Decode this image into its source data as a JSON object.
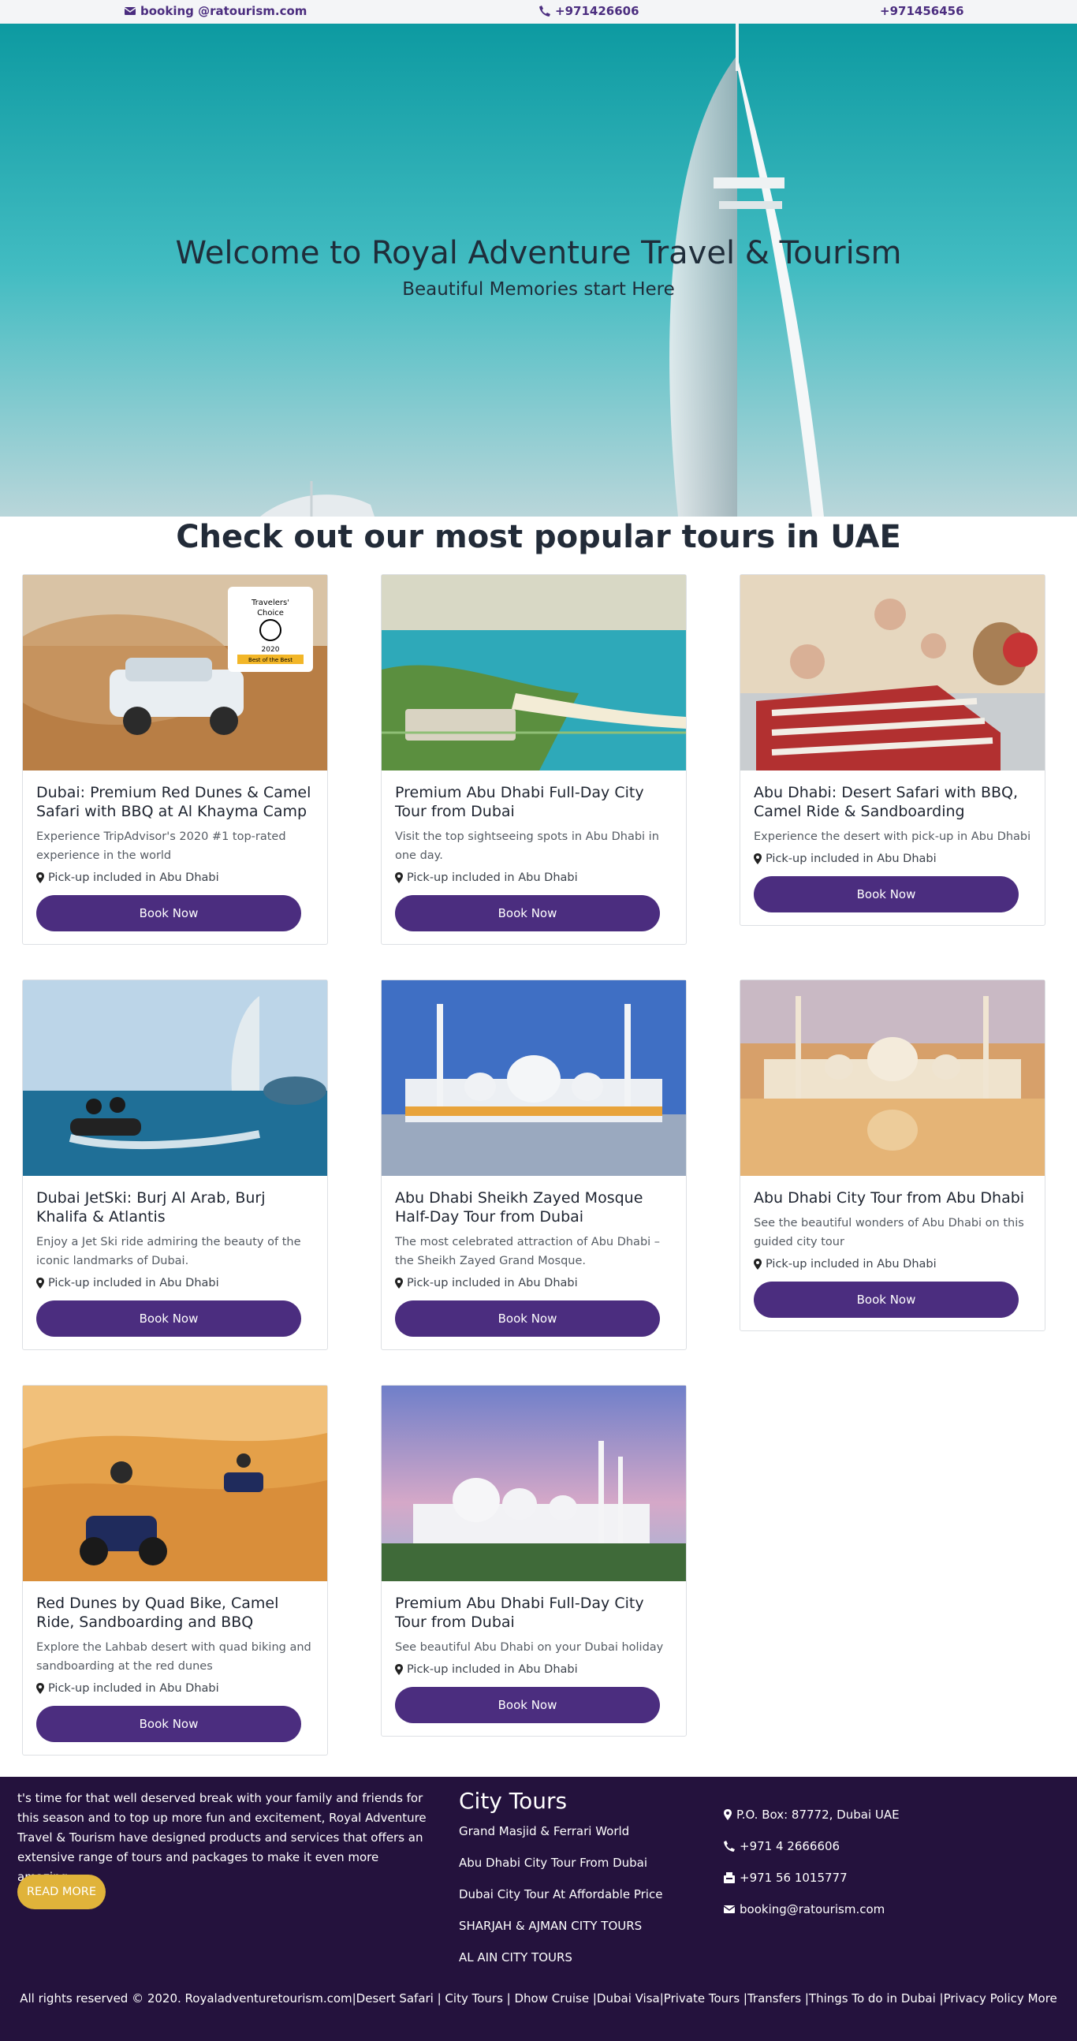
{
  "topbar": {
    "email": "booking @ratourism.com",
    "phone1": "+971426606",
    "phone2": "+971456456"
  },
  "hero": {
    "title": "Welcome to Royal Adventure Travel & Tourism",
    "subtitle": "Beautiful Memories start Here"
  },
  "section": {
    "title": "Check out our most popular tours in UAE"
  },
  "badge": {
    "line1": "Travelers'",
    "line2": "Choice",
    "year": "2020",
    "ribbon": "Best of the Best"
  },
  "tours": [
    {
      "title": "Dubai: Premium Red Dunes & Camel Safari with BBQ at Al Khayma Camp",
      "desc": "Experience TripAdvisor's 2020 #1 top-rated experience in the world",
      "pickup": "Pick-up included in Abu Dhabi",
      "button": "Book Now",
      "image": "desert-suv-image"
    },
    {
      "title": "Premium Abu Dhabi Full-Day City Tour from Dubai",
      "desc": "Visit the top sightseeing spots in Abu Dhabi in one day.",
      "pickup": "Pick-up included in Abu Dhabi",
      "button": "Book Now",
      "image": "coastline-image"
    },
    {
      "title": "Abu Dhabi: Desert Safari with BBQ, Camel Ride & Sandboarding",
      "desc": "Experience the desert with pick-up in Abu Dhabi",
      "pickup": "Pick-up included in Abu Dhabi",
      "button": "Book Now",
      "image": "camel-ride-image"
    },
    {
      "title": "Dubai JetSki: Burj Al Arab, Burj Khalifa & Atlantis",
      "desc": "Enjoy a Jet Ski ride admiring the beauty of the iconic landmarks of Dubai.",
      "pickup": "Pick-up included in Abu Dhabi",
      "button": "Book Now",
      "image": "jetski-image"
    },
    {
      "title": "Abu Dhabi Sheikh Zayed Mosque Half-Day Tour from Dubai",
      "desc": "The most celebrated attraction of Abu Dhabi – the Sheikh Zayed Grand Mosque.",
      "pickup": "Pick-up included in Abu Dhabi",
      "button": "Book Now",
      "image": "mosque-blue-image"
    },
    {
      "title": "Abu Dhabi City Tour from Abu Dhabi",
      "desc": "See the beautiful wonders of Abu Dhabi on this guided city tour",
      "pickup": "Pick-up included in Abu Dhabi",
      "button": "Book Now",
      "image": "mosque-sunset-image"
    },
    {
      "title": "Red Dunes by Quad Bike, Camel Ride, Sandboarding and BBQ",
      "desc": "Explore the Lahbab desert with quad biking and sandboarding at the red dunes",
      "pickup": "Pick-up included in Abu Dhabi",
      "button": "Book Now",
      "image": "quad-bike-image"
    },
    {
      "title": "Premium Abu Dhabi Full-Day City Tour from Dubai",
      "desc": "See beautiful Abu Dhabi on your Dubai holiday",
      "pickup": "Pick-up included in Abu Dhabi",
      "button": "Book Now",
      "image": "mosque-dusk-image"
    }
  ],
  "footer": {
    "about": "t's time for that well deserved break with your family and friends for this season and to top up more fun and excitement, Royal Adventure Travel & Tourism have designed products and services that offers an extensive range of tours and packages to make it even more amazing...",
    "read_more": "READ MORE",
    "city_tours_title": "City Tours",
    "city_tours": [
      "Grand Masjid & Ferrari World",
      "Abu Dhabi City Tour From Dubai",
      "Dubai City Tour At Affordable Price",
      "SHARJAH & AJMAN CITY TOURS",
      "AL AIN CITY TOURS"
    ],
    "contact": {
      "address": "P.O. Box: 87772, Dubai UAE",
      "phone": "+971 4 2666606",
      "fax": "+971 56 1015777",
      "email": "booking@ratourism.com"
    },
    "copyright": "All rights reserved © 2020. Royaladventuretourism.com|Desert Safari | City Tours | Dhow Cruise |Dubai Visa|Private Tours |Transfers |Things To do in Dubai |Privacy Policy More"
  },
  "colors": {
    "brand": "#4b2d7f",
    "footer_bg": "#24123d",
    "accent": "#e0b33a"
  }
}
